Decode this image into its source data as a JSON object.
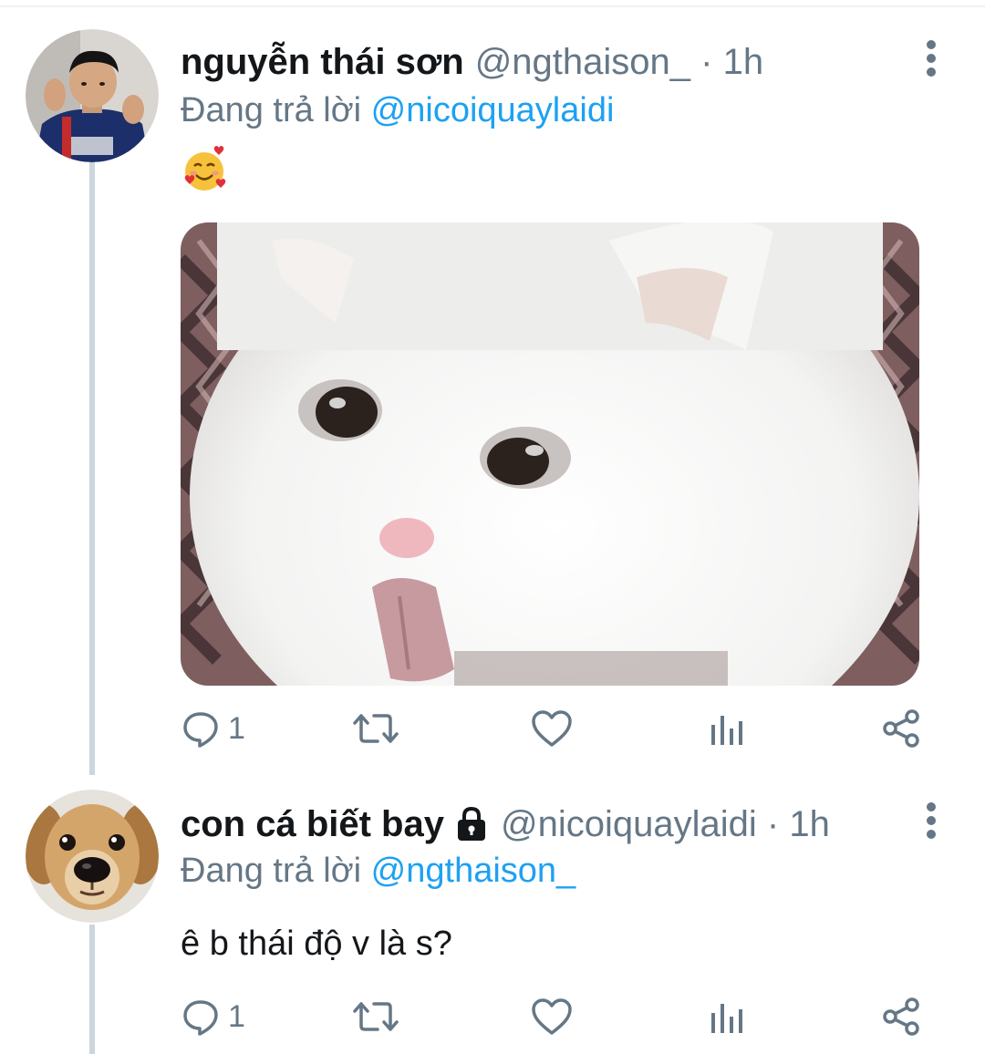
{
  "tweets": [
    {
      "display_name": "nguyễn thái sơn",
      "handle": "@ngthaison_",
      "separator": "·",
      "time": "1h",
      "reply_prefix": "Đang trả lời",
      "reply_to": "@nicoiquaylaidi",
      "body_icon": "smiling-face-with-hearts-icon",
      "media": "white-cat-photo",
      "avatar": "boy-avatar",
      "locked": false,
      "actions": {
        "reply_count": "1",
        "retweet_count": "",
        "like_count": ""
      }
    },
    {
      "display_name": "con cá biết bay",
      "handle": "@nicoiquaylaidi",
      "separator": "·",
      "time": "1h",
      "reply_prefix": "Đang trả lời",
      "reply_to": "@ngthaison_",
      "body_text": "ê b thái độ v là s?",
      "avatar": "puppy-avatar",
      "locked": true,
      "actions": {
        "reply_count": "1",
        "retweet_count": "",
        "like_count": ""
      }
    }
  ],
  "colors": {
    "text_primary": "#14171a",
    "text_secondary": "#657786",
    "accent": "#1da1f2",
    "thread_line": "#ccd6dd"
  }
}
